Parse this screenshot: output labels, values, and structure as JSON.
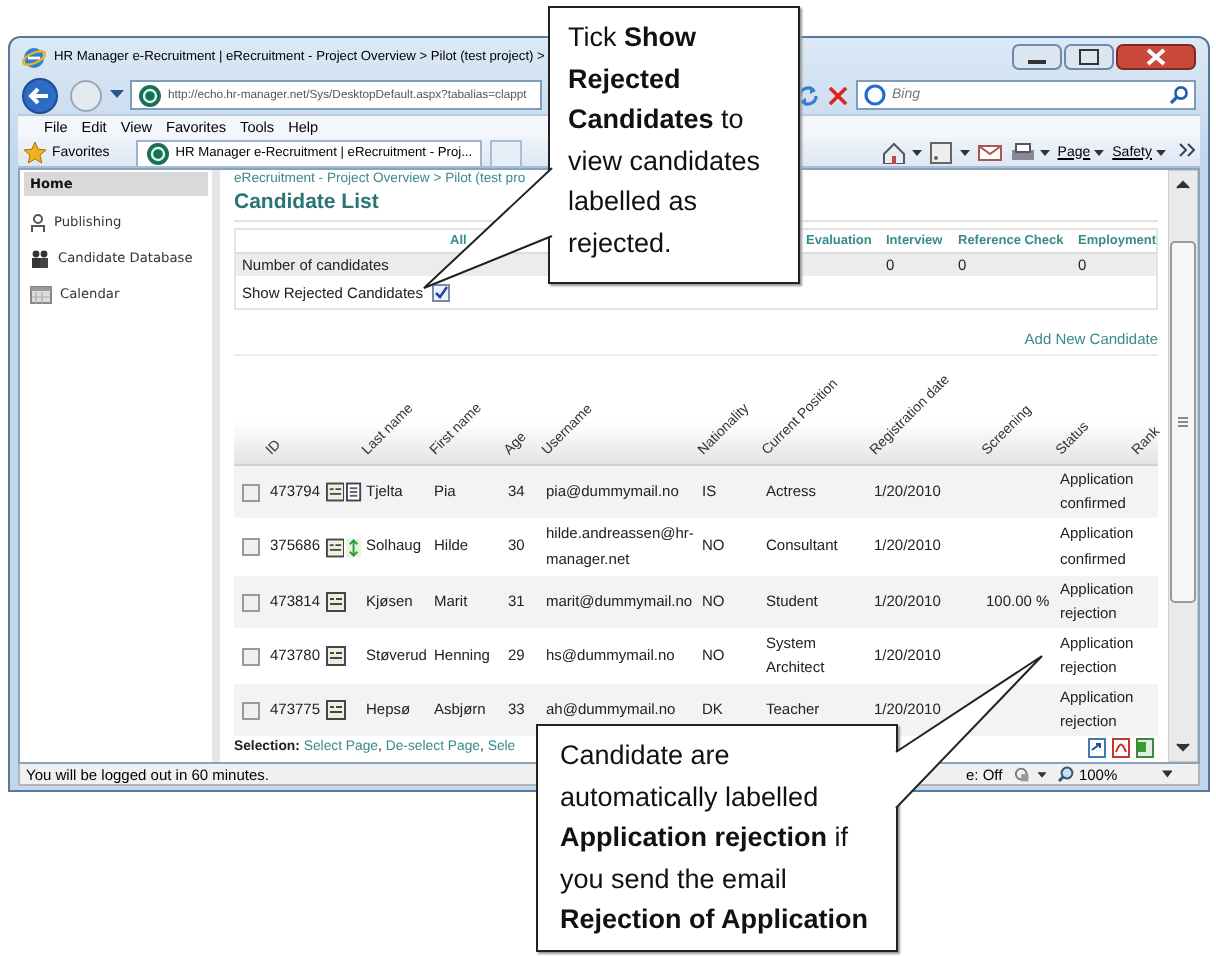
{
  "window": {
    "title": "HR Manager e-Recruitment | eRecruitment - Project Overview > Pilot (test project) >",
    "address": "http://echo.hr-manager.net/Sys/DesktopDefault.aspx?tabalias=clappt",
    "search": {
      "placeholder": "Bing"
    }
  },
  "menu": [
    "File",
    "Edit",
    "View",
    "Favorites",
    "Tools",
    "Help"
  ],
  "favorites_bar": {
    "favorites": "Favorites",
    "tabs": [
      {
        "label": "HR Manager e-Recruitment | eRecruitment - Proj...",
        "selected": true
      }
    ],
    "tools": [
      "Page",
      "Safety"
    ]
  },
  "sidebar": {
    "items": [
      {
        "label": "Home",
        "selected": true
      },
      {
        "label": "Publishing",
        "selected": false
      },
      {
        "label": "Candidate Database",
        "selected": false
      },
      {
        "label": "Calendar",
        "selected": false
      }
    ]
  },
  "breadcrumb": "eRecruitment - Project Overview > Pilot (test pro",
  "heading": "Candidate List",
  "stats": {
    "count_label": "Number of candidates",
    "stages": [
      {
        "label": "All"
      },
      {
        "label": "Evaluation"
      },
      {
        "label": "Interview",
        "count": "0"
      },
      {
        "label": "Reference Check",
        "count": "0"
      },
      {
        "label": "Employment",
        "count": "0"
      }
    ],
    "show_rejected": {
      "label": "Show Rejected Candidates",
      "checked": true
    }
  },
  "add_link": "Add New Candidate",
  "candidates": {
    "columns": [
      "ID",
      "Last name",
      "First name",
      "Age",
      "Username",
      "Nationality",
      "Current Position",
      "Registration date",
      "Screening",
      "Status",
      "Rank"
    ],
    "rows": [
      {
        "checked": false,
        "id": "473794",
        "icons": [
          {
            "kind": "cv"
          },
          {
            "kind": "note"
          }
        ],
        "last_name": "Tjelta",
        "first_name": "Pia",
        "age": "34",
        "username": "pia@dummymail.no",
        "nationality": "IS",
        "position": "Actress",
        "registered": "1/20/2010",
        "status": "Application confirmed"
      },
      {
        "checked": false,
        "id": "375686",
        "icons": [
          {
            "kind": "cv"
          },
          {
            "kind": "swap"
          }
        ],
        "last_name": "Solhaug",
        "first_name": "Hilde",
        "age": "30",
        "username": "hilde.andreassen@hr-manager.net",
        "nationality": "NO",
        "position": "Consultant",
        "registered": "1/20/2010",
        "status": "Application confirmed"
      },
      {
        "checked": false,
        "id": "473814",
        "icons": [
          {
            "kind": "cv"
          }
        ],
        "last_name": "Kjøsen",
        "first_name": "Marit",
        "age": "31",
        "username": "marit@dummymail.no",
        "nationality": "NO",
        "position": "Student",
        "registered": "1/20/2010",
        "screening": "100.00 %",
        "status": "Application rejection"
      },
      {
        "checked": false,
        "id": "473780",
        "icons": [
          {
            "kind": "cv"
          }
        ],
        "last_name": "Støverud",
        "first_name": "Henning",
        "age": "29",
        "username": "hs@dummymail.no",
        "nationality": "NO",
        "position": "System Architect",
        "registered": "1/20/2010",
        "status": "Application rejection"
      },
      {
        "checked": false,
        "id": "473775",
        "icons": [
          {
            "kind": "cv"
          }
        ],
        "last_name": "Hepsø",
        "first_name": "Asbjørn",
        "age": "33",
        "username": "ah@dummymail.no",
        "nationality": "DK",
        "position": "Teacher",
        "registered": "1/20/2010",
        "status": "Application rejection"
      }
    ]
  },
  "selection": {
    "label": "Selection:",
    "links": [
      "Select Page",
      "De-select Page",
      "Sele"
    ],
    "separator": ","
  },
  "status_bar": {
    "message": "You will be logged out in 60 minutes.",
    "mode": "e: Off",
    "zoom": "100%"
  },
  "callouts": [
    {
      "text": "Tick **Show Rejected Candidates** to view candidates labelled as rejected."
    },
    {
      "text": "Candidate are automatically labelled **Application rejection** if you send the email **Rejection of Application**"
    }
  ]
}
